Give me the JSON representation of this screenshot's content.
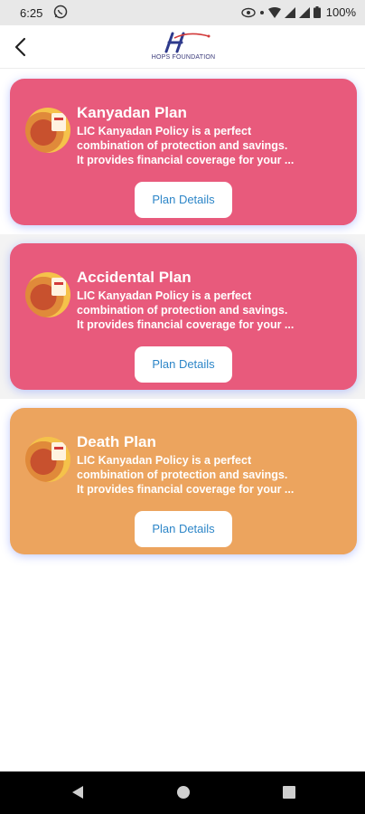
{
  "status": {
    "time": "6:25",
    "battery": "100%"
  },
  "header": {
    "logo_text": "HOPS FOUNDATION"
  },
  "plans": [
    {
      "title": "Kanyadan Plan",
      "desc_line1": "LIC Kanyadan Policy is a perfect",
      "desc_line2": "combination of protection and savings.",
      "desc_line3": "It provides financial coverage for your ...",
      "button": "Plan Details",
      "color": "#e85a7c"
    },
    {
      "title": "Accidental Plan",
      "desc_line1": "LIC Kanyadan Policy is a perfect",
      "desc_line2": "combination of protection and savings.",
      "desc_line3": "It provides financial coverage for your ...",
      "button": "Plan Details",
      "color": "#e85a7c"
    },
    {
      "title": "Death Plan",
      "desc_line1": "LIC Kanyadan Policy is a perfect",
      "desc_line2": "combination of protection and savings.",
      "desc_line3": "It provides financial coverage for your ...",
      "button": "Plan Details",
      "color": "#eca45e"
    }
  ],
  "icons": {
    "back": "back-arrow-icon",
    "whatsapp": "whatsapp-icon",
    "eye": "eye-icon",
    "wifi": "wifi-icon",
    "signal": "signal-icon",
    "battery": "battery-icon"
  }
}
